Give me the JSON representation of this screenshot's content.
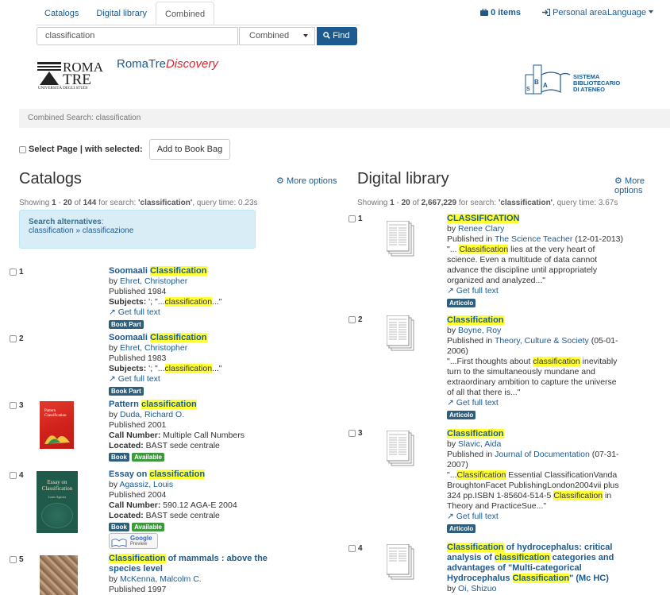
{
  "header": {
    "tabs": [
      {
        "label": "Catalogs"
      },
      {
        "label": "Digital library"
      },
      {
        "label": "Combined"
      }
    ],
    "search_value": "classification",
    "search_type": "Combined",
    "find_label": "Find",
    "items_label": "0 items",
    "personal_area": "Personal area",
    "language": "Language"
  },
  "logos": {
    "rt_line1": "ROMA",
    "rt_line2": "TRE",
    "rt_sub": "UNIVERSITÀ DEGLI STUDI",
    "rt_name": "RomaTre",
    "rt_name_italic": "Discovery",
    "sba_line1": "SISTEMA",
    "sba_line2": "BIBLIOTECARIO",
    "sba_line3": "DI ATENEO",
    "sba_letters": "SBA"
  },
  "breadcrumb": "Combined Search: classification",
  "select_row": {
    "label": "Select Page | with selected:",
    "button": "Add to Book Bag"
  },
  "colors": {
    "link": "#1d5a8f",
    "highlight": "#ffff33",
    "badge": "#2d5f7c",
    "available": "#3c9a3c"
  },
  "catalogs": {
    "title": "Catalogs",
    "more_options": "More options",
    "showing": {
      "prefix": "Showing ",
      "from": "1",
      "sep": " - ",
      "to": "20",
      "of": " of ",
      "total": "144",
      "for": " for search: ",
      "query": "'classification'",
      "time": ", query time: 0.23s"
    },
    "alternatives": {
      "label": "Search alternatives",
      "colon": ":",
      "text": "classification » classificazione"
    },
    "items": [
      {
        "num": "1",
        "title_a": "Soomaali ",
        "title_hl": "Classification",
        "author_by": "by ",
        "author": "Ehret, Christopher",
        "published": "Published 1984",
        "subj_label": "Subjects:",
        "subj_pre": " '; \"...",
        "subj_hl": "classification",
        "subj_post": "...\"",
        "fulltext": "Get full text",
        "badges": [
          "Book Part"
        ]
      },
      {
        "num": "2",
        "title_a": "Soomaali ",
        "title_hl": "Classification",
        "author_by": "by ",
        "author": "Ehret, Christopher",
        "published": "Published 1983",
        "subj_label": "Subjects:",
        "subj_pre": " '; \"...",
        "subj_hl": "classification",
        "subj_post": "...\"",
        "fulltext": "Get full text",
        "badges": [
          "Book Part"
        ]
      },
      {
        "num": "3",
        "title_a": "Pattern ",
        "title_hl": "classification",
        "author_by": "by ",
        "author": "Duda, Richard O.",
        "published": "Published 2001",
        "call_label": "Call Number:",
        "call": " Multiple Call Numbers",
        "loc_label": "Located:",
        "loc": " BAST sede centrale",
        "badges": [
          "Book",
          "Available"
        ],
        "cover_text": "Pattern Classification"
      },
      {
        "num": "4",
        "title_a": "Essay on ",
        "title_hl": "classification",
        "author_by": "by ",
        "author": "Agassiz, Louis",
        "published": "Published 2004",
        "call_label": "Call Number:",
        "call": " 590.12 AGA-E 2004",
        "loc_label": "Located:",
        "loc": " BAST sede centrale",
        "badges": [
          "Book",
          "Available"
        ],
        "cover_text": "Essay on Classification",
        "cover_author": "Louis Agassiz",
        "google": "Google",
        "preview": "Preview"
      },
      {
        "num": "5",
        "title_hl": "Classification",
        "title_b": " of mammals : above the species level",
        "author_by": "by ",
        "author": "McKenna, Malcolm C.",
        "published": "Published 1997"
      }
    ]
  },
  "digital": {
    "title": "Digital library",
    "more_options": "More options",
    "showing": {
      "prefix": "Showing ",
      "from": "1",
      "sep": " - ",
      "to": "20",
      "of": " of ",
      "total": "2,667,229",
      "for": " for search: ",
      "query": "'classification'",
      "time": ", query time: 3.67s"
    },
    "items": [
      {
        "num": "1",
        "title_hl": "CLASSIFICATION",
        "author_by": "by ",
        "author": "Renee Clary",
        "pub_pre": "Published in ",
        "journal": "The Science Teacher",
        "date": " (12-01-2013)",
        "snip_pre": "\"... ",
        "snip_hl": "Classification",
        "snip_post": " lies at the very heart of science. Even a multitude of data cannot advance the discipline until appropriately organized and analyzed...\"",
        "fulltext": "Get full text",
        "badge": "Articolo"
      },
      {
        "num": "2",
        "title_hl": "Classification",
        "author_by": "by ",
        "author": "Boyne, Roy",
        "pub_pre": "Published in ",
        "journal": "Theory, Culture & Society",
        "date": " (05-01-2006)",
        "snip_pre": "\"...First thoughts about ",
        "snip_hl": "classification",
        "snip_post": " inevitably turn to the simultaneously mundane and extraordinary ambition to capture the universe of all that there is...\"",
        "fulltext": "Get full text",
        "badge": "Articolo"
      },
      {
        "num": "3",
        "title_hl": "Classification",
        "author_by": "by ",
        "author": "Slavic, Aida",
        "pub_pre": "Published in ",
        "journal": "Journal of Documentation",
        "date": " (07-31-2007)",
        "snip_pre": "\"...",
        "snip_hl": "Classification",
        "snip_mid": " Essential ClassificationVanda BroughtonFacet PublishingLondon2004vii plus 324 pp.ISBN 1-85604-514-5 ",
        "snip_hl2": "Classification",
        "snip_post": " in Theory and PracticeSue...\"",
        "fulltext": "Get full text",
        "badge": "Articolo"
      },
      {
        "num": "4",
        "title_hl": "Classification",
        "title_a": " of hydrocephalus: critical analysis of ",
        "title_hl2": "classification",
        "title_b": " categories and advantages of \"Multi-categorical Hydrocephalus ",
        "title_hl3": "Classification",
        "title_c": "\" (Mc HC)",
        "author_by": "by ",
        "author": "Oi, Shizuo"
      }
    ]
  }
}
